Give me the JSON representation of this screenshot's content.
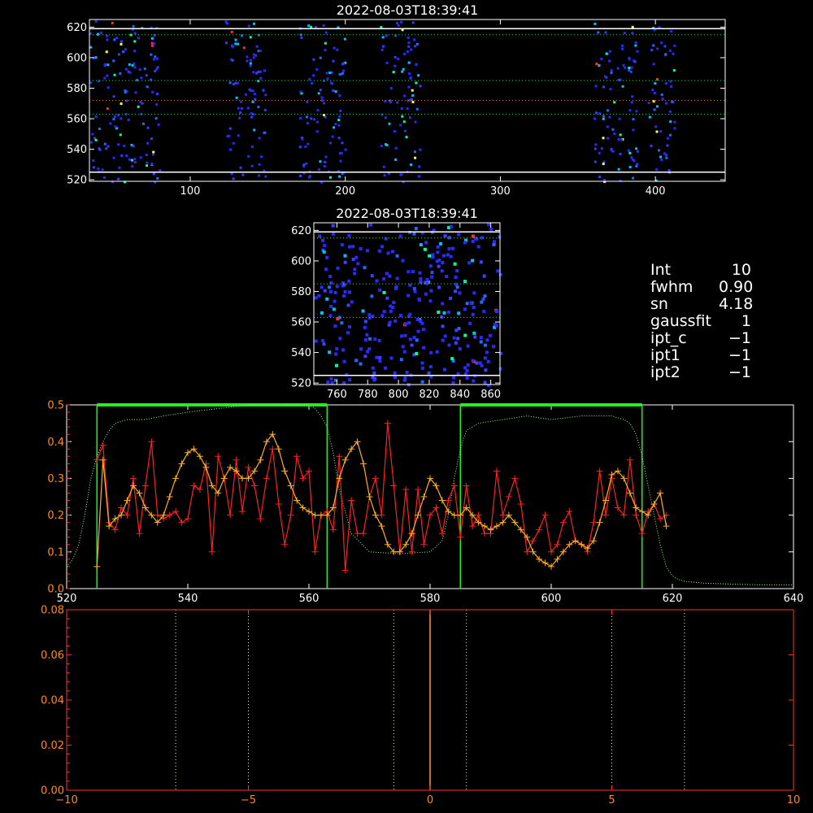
{
  "params": [
    {
      "key": "Int",
      "value": "10"
    },
    {
      "key": "fwhm",
      "value": "0.90"
    },
    {
      "key": "sn",
      "value": "4.18"
    },
    {
      "key": "gaussfit",
      "value": "1"
    },
    {
      "key": "ipt_c",
      "value": "−1"
    },
    {
      "key": "ipt1",
      "value": "−1"
    },
    {
      "key": "ipt2",
      "value": "−1"
    }
  ],
  "chart_data": [
    {
      "type": "heatmap",
      "title": "2022-08-03T18:39:41",
      "xlim": [
        35,
        445
      ],
      "ylim": [
        519,
        625
      ],
      "xticks": [
        "100",
        "200",
        "300",
        "400"
      ],
      "xtick_values": [
        100,
        200,
        300,
        400
      ],
      "yticks": [
        "520",
        "540",
        "560",
        "580",
        "600",
        "620"
      ],
      "ytick_values": [
        520,
        540,
        560,
        580,
        600,
        620
      ],
      "hlines_solid": [
        525,
        619
      ],
      "hlines_dotted": [
        563,
        572,
        585,
        615
      ],
      "bands": [
        [
          35,
          80
        ],
        [
          122,
          148
        ],
        [
          170,
          200
        ],
        [
          222,
          248
        ],
        [
          360,
          388
        ],
        [
          395,
          412
        ]
      ],
      "colors": [
        "#2a2aff",
        "#3a3aff",
        "#1f6bff",
        "#00c0ff",
        "#00ffa0",
        "#ffff40",
        "#ff3030"
      ]
    },
    {
      "type": "heatmap",
      "title": "2022-08-03T18:39:41",
      "xlim": [
        745,
        866
      ],
      "ylim": [
        519,
        625
      ],
      "xticks": [
        "760",
        "780",
        "800",
        "820",
        "840",
        "860"
      ],
      "xtick_values": [
        760,
        780,
        800,
        820,
        840,
        860
      ],
      "yticks": [
        "520",
        "540",
        "560",
        "580",
        "600",
        "620"
      ],
      "ytick_values": [
        520,
        540,
        560,
        580,
        600,
        620
      ],
      "hlines_solid": [
        525,
        619
      ],
      "hlines_dotted": [
        563,
        585,
        615
      ]
    },
    {
      "type": "line",
      "xlim": [
        520,
        640
      ],
      "ylim": [
        0,
        0.5
      ],
      "xticks": [
        "520",
        "540",
        "560",
        "580",
        "600",
        "620",
        "640"
      ],
      "xtick_values": [
        520,
        540,
        560,
        580,
        600,
        620,
        640
      ],
      "yticks": [
        "0.0",
        "0.1",
        "0.2",
        "0.3",
        "0.4",
        "0.5"
      ],
      "ytick_values": [
        0,
        0.1,
        0.2,
        0.3,
        0.4,
        0.5
      ],
      "windows": [
        [
          525,
          563
        ],
        [
          585,
          615
        ]
      ],
      "window_top": 0.5,
      "profile_x": [
        520,
        521,
        522,
        523,
        524,
        525,
        526,
        527,
        528,
        530,
        533,
        536,
        540,
        545,
        550,
        555,
        558,
        560,
        561,
        562,
        563,
        564,
        565,
        567,
        570,
        575,
        580,
        582,
        583,
        584,
        585,
        586,
        588,
        592,
        596,
        600,
        605,
        610,
        612,
        613,
        614,
        615,
        616,
        617,
        618,
        619,
        620,
        621,
        622,
        625,
        630,
        635,
        640
      ],
      "profile_y": [
        0.06,
        0.08,
        0.12,
        0.2,
        0.3,
        0.36,
        0.4,
        0.43,
        0.45,
        0.46,
        0.46,
        0.47,
        0.48,
        0.49,
        0.5,
        0.5,
        0.5,
        0.5,
        0.49,
        0.47,
        0.44,
        0.37,
        0.27,
        0.15,
        0.1,
        0.095,
        0.1,
        0.13,
        0.2,
        0.3,
        0.38,
        0.43,
        0.45,
        0.46,
        0.47,
        0.46,
        0.47,
        0.47,
        0.46,
        0.45,
        0.42,
        0.36,
        0.28,
        0.2,
        0.12,
        0.06,
        0.035,
        0.025,
        0.02,
        0.015,
        0.012,
        0.01,
        0.01
      ],
      "series": [
        {
          "color": "#ff2020",
          "x": [
            525,
            526,
            527,
            528,
            529,
            530,
            531,
            532,
            533,
            534,
            535,
            536,
            537,
            538,
            539,
            540,
            541,
            542,
            543,
            544,
            545,
            546,
            547,
            548,
            549,
            550,
            551,
            552,
            553,
            554,
            555,
            556,
            557,
            558,
            559,
            560,
            561,
            562,
            563,
            564,
            565,
            566,
            567,
            568,
            569,
            570,
            571,
            572,
            573,
            574,
            575,
            576,
            577,
            578,
            579,
            580,
            581,
            582,
            583,
            584,
            585,
            586,
            587,
            588,
            589,
            590,
            591,
            592,
            593,
            594,
            595,
            596,
            597,
            598,
            599,
            600,
            601,
            602,
            603,
            604,
            605,
            606,
            607,
            608,
            609,
            610,
            611,
            612,
            613,
            614,
            615,
            616,
            617,
            618,
            619
          ],
          "y": [
            0.35,
            0.39,
            0.18,
            0.16,
            0.22,
            0.2,
            0.3,
            0.15,
            0.28,
            0.4,
            0.2,
            0.19,
            0.2,
            0.21,
            0.18,
            0.19,
            0.28,
            0.27,
            0.34,
            0.1,
            0.36,
            0.3,
            0.2,
            0.35,
            0.21,
            0.33,
            0.28,
            0.19,
            0.3,
            0.38,
            0.23,
            0.12,
            0.2,
            0.36,
            0.3,
            0.32,
            0.1,
            0.2,
            0.21,
            0.16,
            0.36,
            0.05,
            0.24,
            0.15,
            0.15,
            0.25,
            0.3,
            0.2,
            0.45,
            0.28,
            0.1,
            0.27,
            0.1,
            0.27,
            0.12,
            0.2,
            0.22,
            0.15,
            0.24,
            0.28,
            0.14,
            0.28,
            0.17,
            0.2,
            0.15,
            0.15,
            0.32,
            0.2,
            0.25,
            0.3,
            0.23,
            0.1,
            0.13,
            0.16,
            0.2,
            0.1,
            0.12,
            0.18,
            0.21,
            0.13,
            0.12,
            0.1,
            0.18,
            0.32,
            0.2,
            0.3,
            0.22,
            0.2,
            0.35,
            0.2,
            0.15,
            0.21,
            0.23,
            0.19,
            0.2
          ]
        },
        {
          "color": "#ffb020",
          "x": [
            525,
            526,
            527,
            528,
            529,
            530,
            531,
            532,
            533,
            534,
            535,
            536,
            537,
            538,
            539,
            540,
            541,
            542,
            543,
            544,
            545,
            546,
            547,
            548,
            549,
            550,
            551,
            552,
            553,
            554,
            555,
            556,
            557,
            558,
            559,
            560,
            561,
            562,
            563,
            564,
            565,
            566,
            567,
            568,
            569,
            570,
            571,
            572,
            573,
            574,
            575,
            576,
            577,
            578,
            579,
            580,
            581,
            582,
            583,
            584,
            585,
            586,
            587,
            588,
            589,
            590,
            591,
            592,
            593,
            594,
            595,
            596,
            597,
            598,
            599,
            600,
            601,
            602,
            603,
            604,
            605,
            606,
            607,
            608,
            609,
            610,
            611,
            612,
            613,
            614,
            615,
            616,
            617,
            618,
            619
          ],
          "y": [
            0.06,
            0.35,
            0.17,
            0.19,
            0.2,
            0.24,
            0.28,
            0.26,
            0.22,
            0.2,
            0.18,
            0.2,
            0.25,
            0.3,
            0.34,
            0.37,
            0.38,
            0.36,
            0.33,
            0.28,
            0.26,
            0.3,
            0.33,
            0.32,
            0.3,
            0.3,
            0.32,
            0.35,
            0.4,
            0.42,
            0.38,
            0.32,
            0.28,
            0.24,
            0.22,
            0.21,
            0.2,
            0.2,
            0.2,
            0.22,
            0.3,
            0.35,
            0.38,
            0.4,
            0.34,
            0.25,
            0.2,
            0.17,
            0.12,
            0.1,
            0.1,
            0.12,
            0.15,
            0.2,
            0.25,
            0.3,
            0.28,
            0.24,
            0.21,
            0.2,
            0.2,
            0.22,
            0.2,
            0.18,
            0.17,
            0.16,
            0.17,
            0.18,
            0.2,
            0.18,
            0.16,
            0.14,
            0.1,
            0.08,
            0.07,
            0.06,
            0.08,
            0.1,
            0.12,
            0.13,
            0.12,
            0.11,
            0.13,
            0.18,
            0.24,
            0.31,
            0.32,
            0.3,
            0.26,
            0.22,
            0.21,
            0.2,
            0.23,
            0.26,
            0.17
          ]
        }
      ]
    },
    {
      "type": "line",
      "xlim": [
        -10,
        10
      ],
      "ylim": [
        0,
        0.08
      ],
      "xticks": [
        "−10",
        "−5",
        "0",
        "5",
        "10"
      ],
      "xtick_values": [
        -10,
        -5,
        0,
        5,
        10
      ],
      "yticks": [
        "0.00",
        "0.02",
        "0.04",
        "0.06",
        "0.08"
      ],
      "ytick_values": [
        0,
        0.02,
        0.04,
        0.06,
        0.08
      ],
      "vlines_dotted": [
        -7,
        -5,
        -1,
        1,
        5,
        7
      ],
      "vline_solid": 0
    }
  ]
}
